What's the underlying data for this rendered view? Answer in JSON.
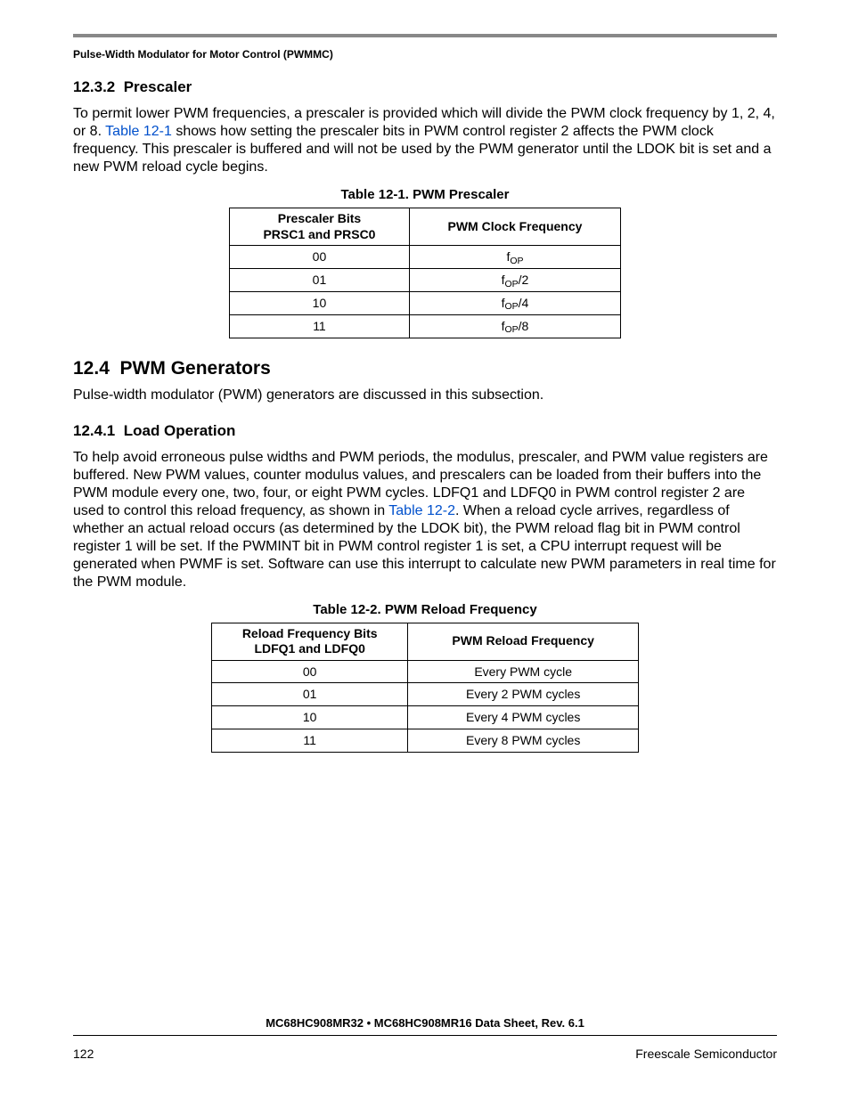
{
  "header": "Pulse-Width Modulator for Motor Control (PWMMC)",
  "sec1": {
    "num": "12.3.2",
    "title": "Prescaler",
    "para_a": "To permit lower PWM frequencies, a prescaler is provided which will divide the PWM clock frequency by 1, 2, 4, or 8. ",
    "link1": "Table 12-1",
    "para_b": " shows how setting the prescaler bits in PWM control register 2 affects the PWM clock frequency. This prescaler is buffered and will not be used by the PWM generator until the LDOK bit is set and a new PWM reload cycle begins."
  },
  "table1": {
    "title": "Table 12-1. PWM Prescaler",
    "h1a": "Prescaler Bits",
    "h1b": "PRSC1 and PRSC0",
    "h2": "PWM Clock Frequency",
    "rows": [
      {
        "bits": "00",
        "freq_pre": "f",
        "freq_sub": "OP",
        "freq_suf": ""
      },
      {
        "bits": "01",
        "freq_pre": "f",
        "freq_sub": "OP",
        "freq_suf": "/2"
      },
      {
        "bits": "10",
        "freq_pre": "f",
        "freq_sub": "OP",
        "freq_suf": "/4"
      },
      {
        "bits": "11",
        "freq_pre": "f",
        "freq_sub": "OP",
        "freq_suf": "/8"
      }
    ]
  },
  "sec2": {
    "num": "12.4",
    "title": "PWM Generators",
    "intro": "Pulse-width modulator (PWM) generators are discussed in this subsection."
  },
  "sec3": {
    "num": "12.4.1",
    "title": "Load Operation",
    "para_a": "To help avoid erroneous pulse widths and PWM periods, the modulus, prescaler, and PWM value registers are buffered. New PWM values, counter modulus values, and prescalers can be loaded from their buffers into the PWM module every one, two, four, or eight PWM cycles. LDFQ1 and LDFQ0 in PWM control register 2 are used to control this reload frequency, as shown in ",
    "link1": "Table 12-2",
    "para_b": ". When a reload cycle arrives, regardless of whether an actual reload occurs (as determined by the LDOK bit), the PWM reload flag bit in PWM control register 1 will be set. If the PWMINT bit in PWM control register 1 is set, a CPU interrupt request will be generated when PWMF is set. Software can use this interrupt to calculate new PWM parameters in real time for the PWM module."
  },
  "table2": {
    "title": "Table 12-2. PWM Reload Frequency",
    "h1a": "Reload Frequency Bits",
    "h1b": "LDFQ1 and LDFQ0",
    "h2": "PWM Reload Frequency",
    "rows": [
      {
        "bits": "00",
        "val": "Every PWM cycle"
      },
      {
        "bits": "01",
        "val": "Every 2 PWM cycles"
      },
      {
        "bits": "10",
        "val": "Every 4 PWM cycles"
      },
      {
        "bits": "11",
        "val": "Every 8 PWM cycles"
      }
    ]
  },
  "footer": {
    "doc": "MC68HC908MR32 • MC68HC908MR16 Data Sheet, Rev. 6.1",
    "page": "122",
    "company": "Freescale Semiconductor"
  }
}
